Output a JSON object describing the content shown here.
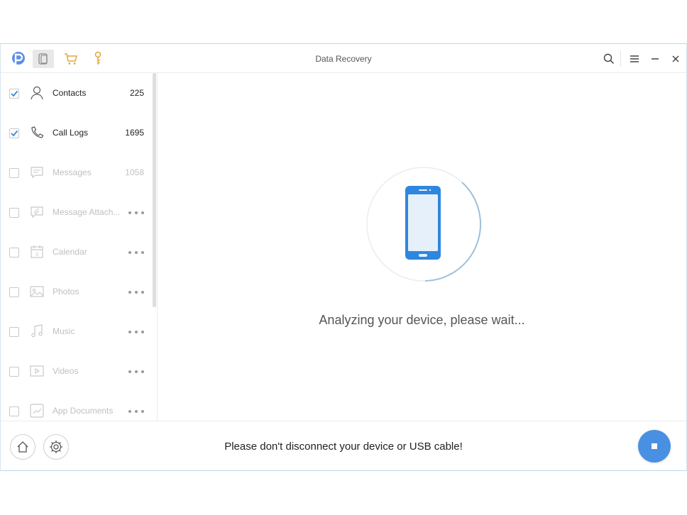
{
  "window": {
    "title": "Data Recovery"
  },
  "categories": [
    {
      "label": "Contacts",
      "count": "225",
      "checked": true
    },
    {
      "label": "Call Logs",
      "count": "1695",
      "checked": true
    },
    {
      "label": "Messages",
      "count": "1058",
      "checked": false
    },
    {
      "label": "Message Attach...",
      "count": "",
      "checked": false
    },
    {
      "label": "Calendar",
      "count": "",
      "checked": false
    },
    {
      "label": "Photos",
      "count": "",
      "checked": false
    },
    {
      "label": "Music",
      "count": "",
      "checked": false
    },
    {
      "label": "Videos",
      "count": "",
      "checked": false
    },
    {
      "label": "App Documents",
      "count": "",
      "checked": false
    }
  ],
  "main": {
    "status_text": "Analyzing your device, please wait..."
  },
  "footer": {
    "notice": "Please don't disconnect your device or USB cable!"
  },
  "colors": {
    "accent": "#4a90e2",
    "logo": "#5b8ee6",
    "cart": "#e2a53c",
    "key": "#e2a53c"
  },
  "icons": {
    "logo": "phonerescue-logo-icon",
    "device": "device-icon",
    "cart": "cart-icon",
    "key": "key-icon",
    "search": "search-icon",
    "menu": "menu-icon",
    "minimize": "minimize-icon",
    "close": "close-icon",
    "home": "home-icon",
    "settings": "gear-icon",
    "stop": "stop-icon"
  }
}
